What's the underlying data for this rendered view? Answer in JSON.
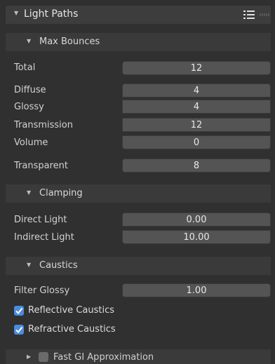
{
  "panel": {
    "title": "Light Paths",
    "expanded": true
  },
  "max_bounces": {
    "title": "Max Bounces",
    "total": {
      "label": "Total",
      "value": "12"
    },
    "diffuse": {
      "label": "Diffuse",
      "value": "4"
    },
    "glossy": {
      "label": "Glossy",
      "value": "4"
    },
    "transmission": {
      "label": "Transmission",
      "value": "12"
    },
    "volume": {
      "label": "Volume",
      "value": "0"
    },
    "transparent": {
      "label": "Transparent",
      "value": "8"
    }
  },
  "clamping": {
    "title": "Clamping",
    "direct_light": {
      "label": "Direct Light",
      "value": "0.00"
    },
    "indirect_light": {
      "label": "Indirect Light",
      "value": "10.00"
    }
  },
  "caustics": {
    "title": "Caustics",
    "filter_glossy": {
      "label": "Filter Glossy",
      "value": "1.00"
    },
    "reflective": {
      "label": "Reflective Caustics",
      "checked": true
    },
    "refractive": {
      "label": "Refractive Caustics",
      "checked": true
    }
  },
  "fast_gi": {
    "title": "Fast GI Approximation",
    "enabled": false,
    "expanded": false
  },
  "colors": {
    "accent": "#4a8de0",
    "background": "#303030",
    "field": "#545454"
  }
}
